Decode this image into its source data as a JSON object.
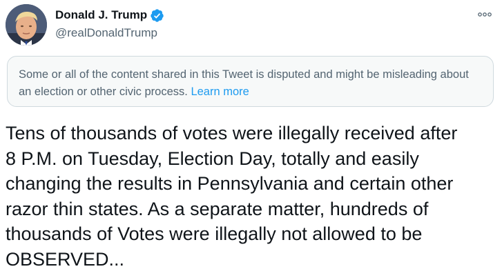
{
  "author": {
    "display_name": "Donald J. Trump",
    "handle": "@realDonaldTrump",
    "verified_icon": "verified-badge-icon",
    "avatar_icon": "avatar"
  },
  "actions": {
    "more_icon": "more-horizontal-icon"
  },
  "notice": {
    "text": "Some or all of the content shared in this Tweet is disputed and might be misleading about an election or other civic process.",
    "link_label": "Learn more"
  },
  "tweet": {
    "lines": [
      "Tens of thousands of votes were illegally received after",
      "8 P.M. on Tuesday, Election Day, totally and easily",
      "changing the results in Pennsylvania and certain other",
      "razor thin states. As a separate matter, hundreds of",
      "thousands of Votes were illegally not allowed to be",
      "OBSERVED..."
    ]
  },
  "colors": {
    "accent": "#1d9bf0",
    "text_primary": "#0f1419",
    "text_secondary": "#536471",
    "notice_background": "#f7f9f9",
    "notice_border": "#cfd9de"
  }
}
